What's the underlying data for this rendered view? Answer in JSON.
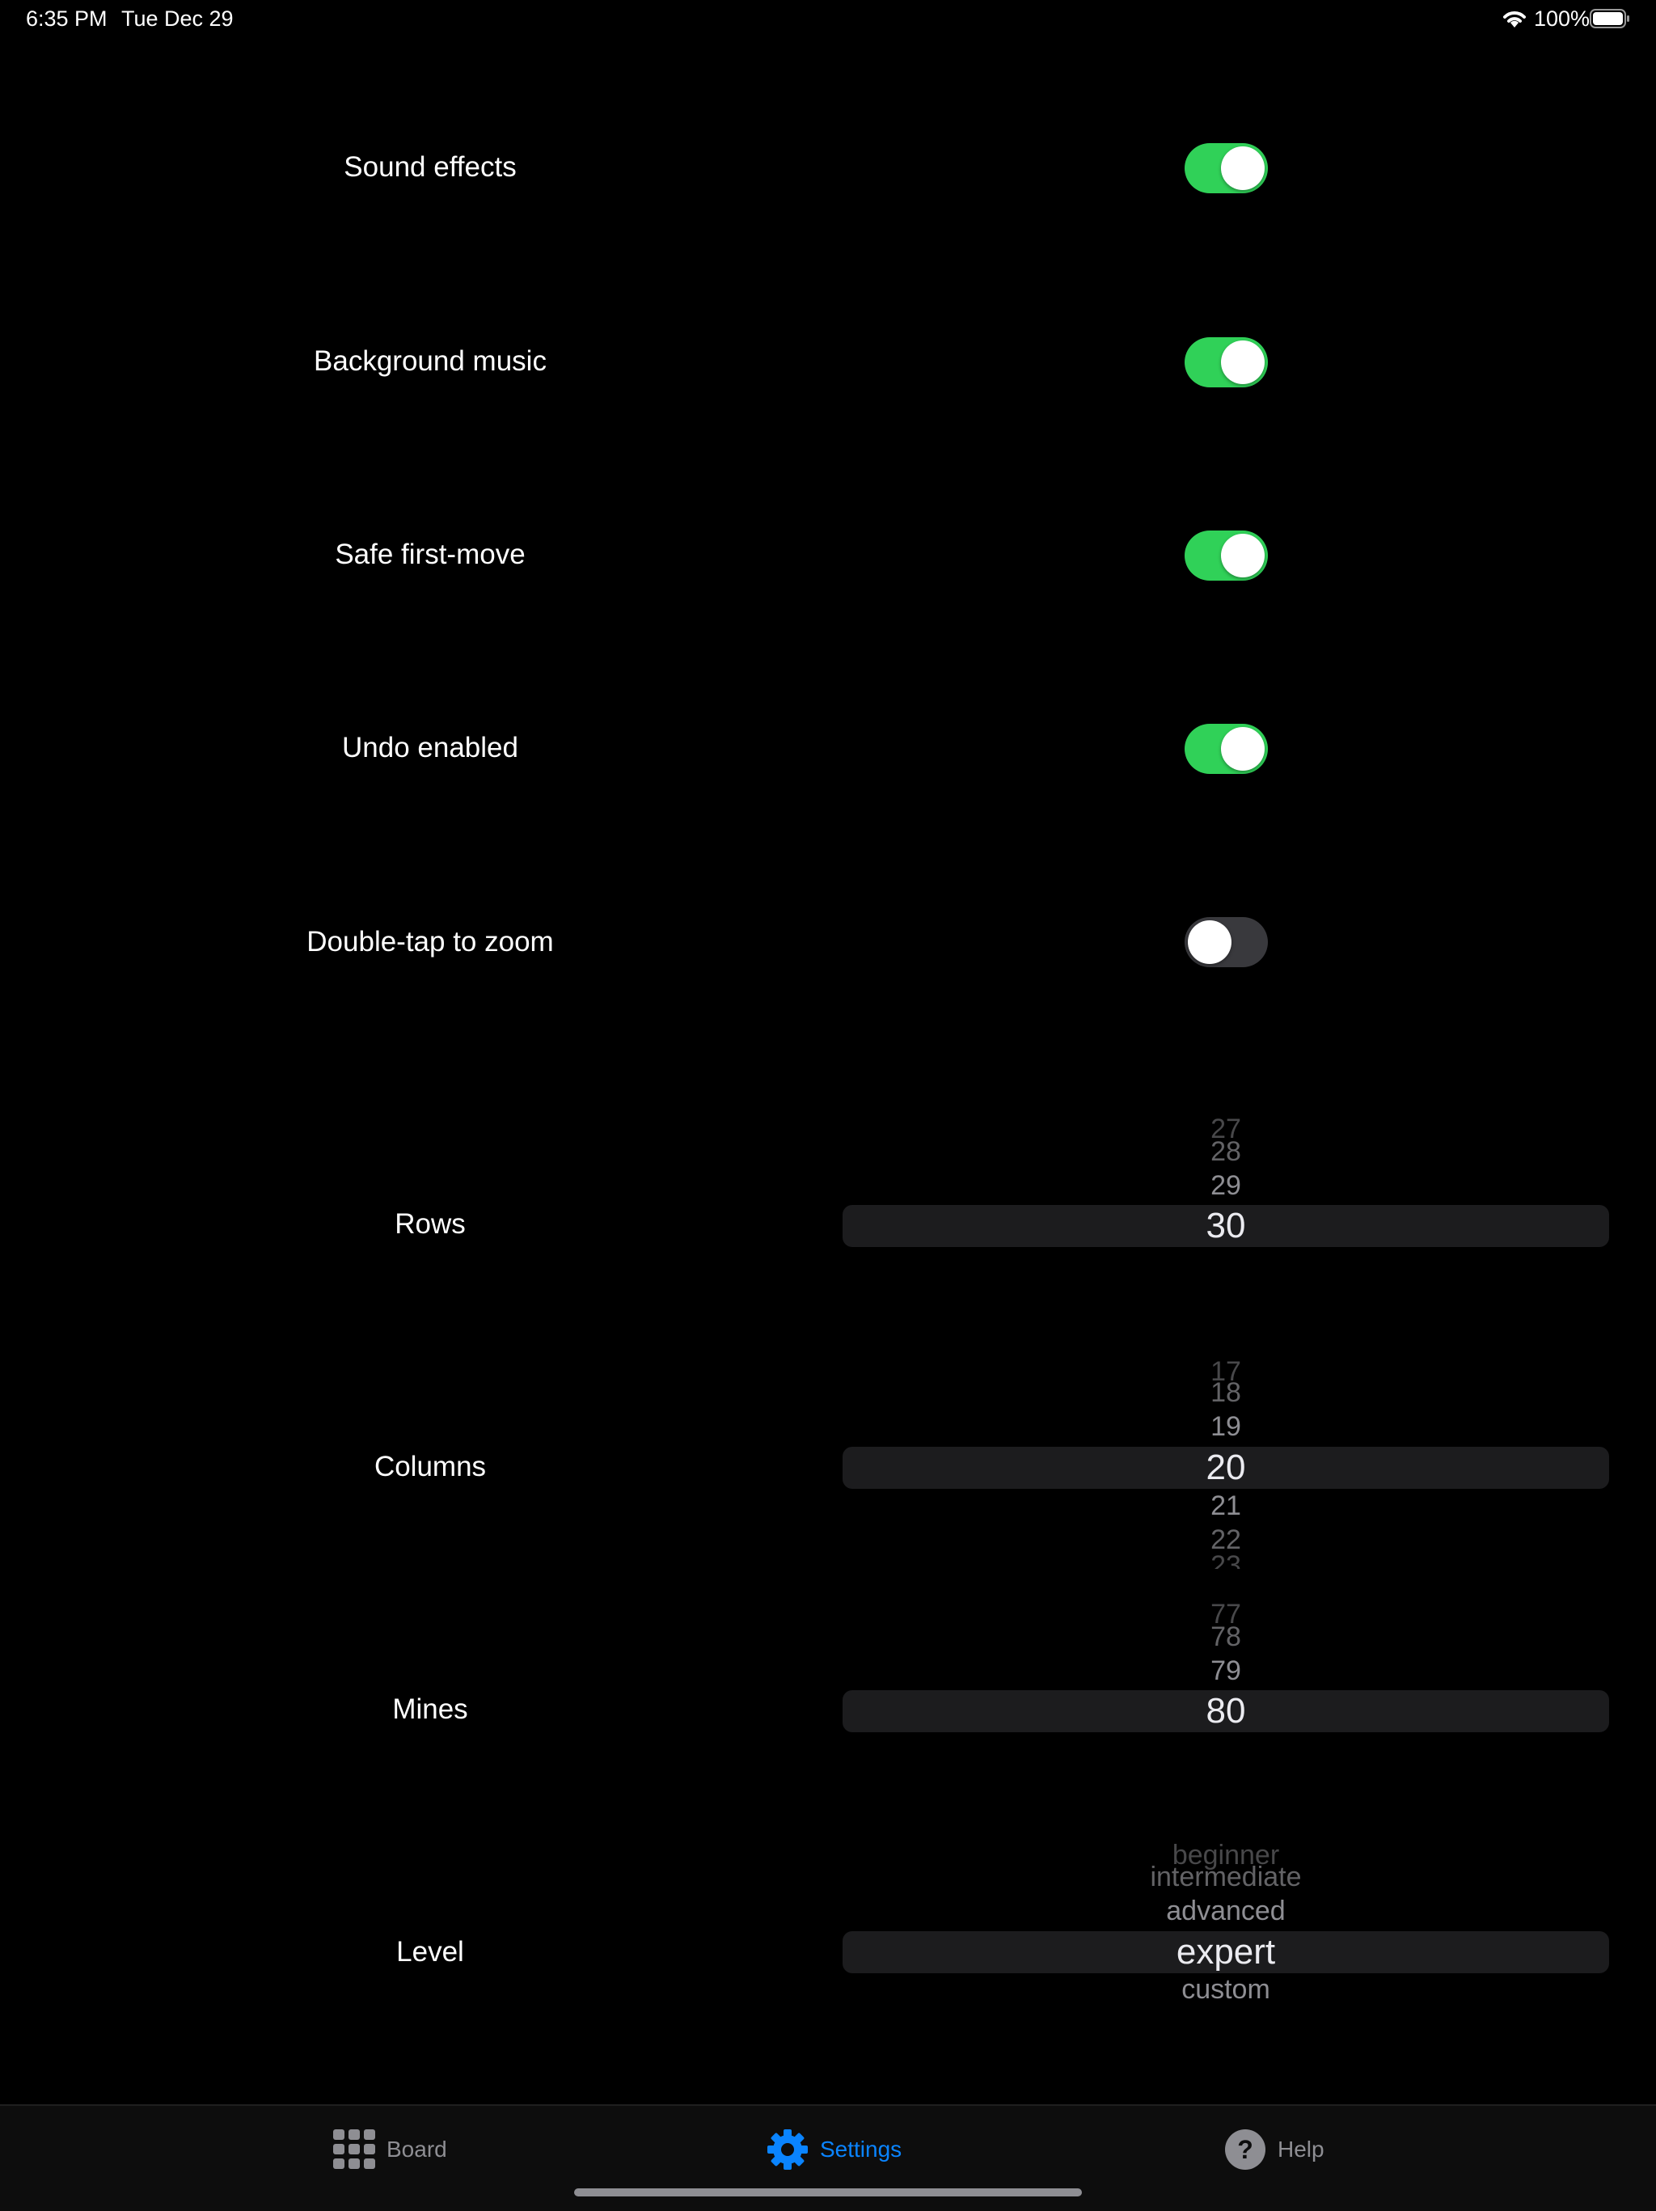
{
  "status_bar": {
    "time": "6:35 PM",
    "date": "Tue Dec 29",
    "battery": "100%"
  },
  "settings": {
    "toggles": [
      {
        "label": "Sound effects",
        "on": true
      },
      {
        "label": "Background music",
        "on": true
      },
      {
        "label": "Safe first-move",
        "on": true
      },
      {
        "label": "Undo enabled",
        "on": true
      },
      {
        "label": "Double-tap to zoom",
        "on": false
      }
    ],
    "pickers": {
      "rows": {
        "label": "Rows",
        "options": [
          "27",
          "28",
          "29",
          "30"
        ],
        "selected": "30"
      },
      "columns": {
        "label": "Columns",
        "options": [
          "17",
          "18",
          "19",
          "20",
          "21",
          "22",
          "23"
        ],
        "selected": "20"
      },
      "mines": {
        "label": "Mines",
        "options": [
          "77",
          "78",
          "79",
          "80"
        ],
        "selected": "80"
      },
      "level": {
        "label": "Level",
        "options": [
          "beginner",
          "intermediate",
          "advanced",
          "expert",
          "custom"
        ],
        "selected": "expert"
      }
    }
  },
  "tab_bar": {
    "tabs": [
      {
        "label": "Board",
        "icon": "grid-icon",
        "active": false
      },
      {
        "label": "Settings",
        "icon": "gear-icon",
        "active": true
      },
      {
        "label": "Help",
        "icon": "question-circle-icon",
        "active": false
      }
    ]
  },
  "colors": {
    "switch_on": "#30d158",
    "accent": "#0a84ff",
    "background": "#000000"
  }
}
